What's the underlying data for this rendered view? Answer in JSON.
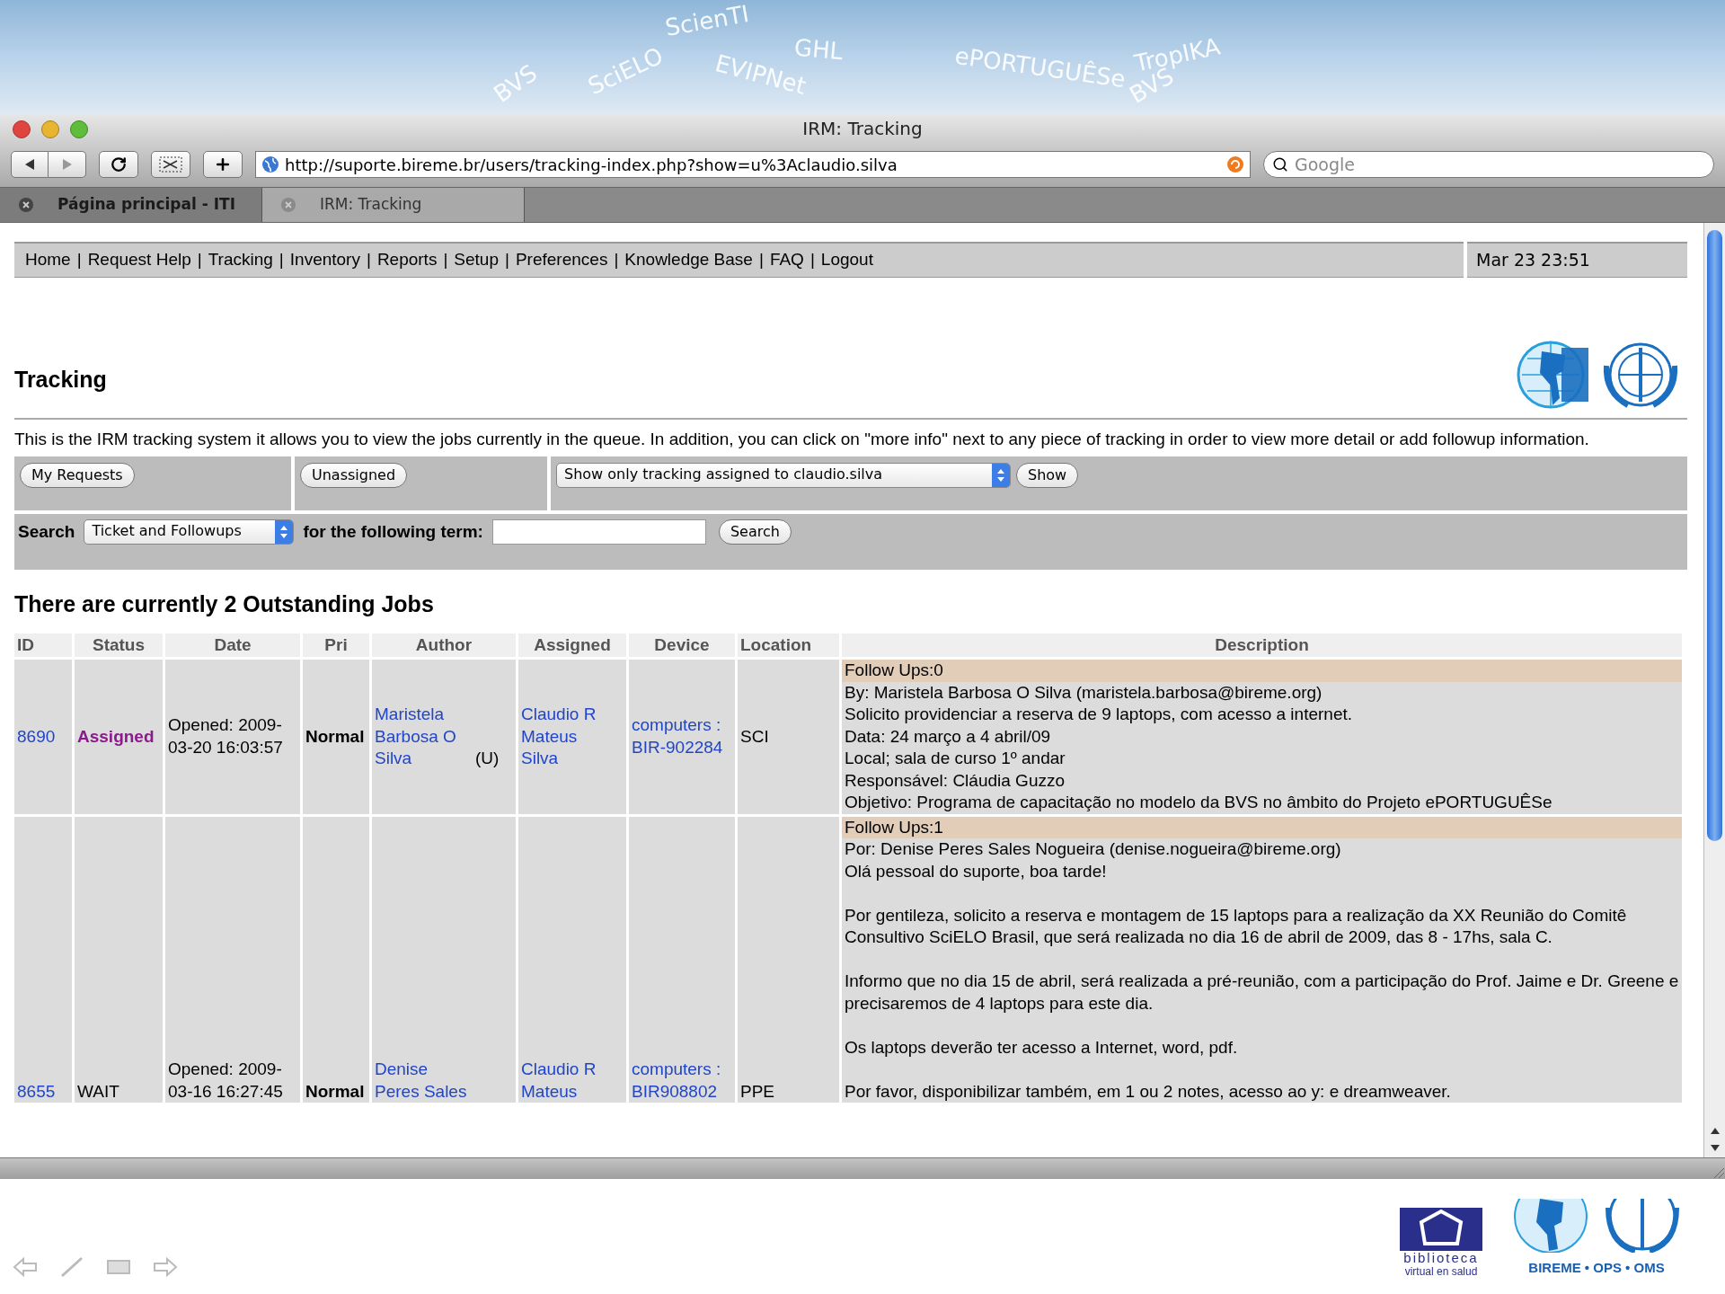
{
  "banner": {
    "words": [
      "ScienTI",
      "GHL",
      "BVS",
      "SciELO",
      "EVIPNet",
      "ePORTUGUÊSe",
      "TropIKA",
      "BVS"
    ]
  },
  "window": {
    "title": "IRM: Tracking"
  },
  "toolbar": {
    "url": "http://suporte.bireme.br/users/tracking-index.php?show=u%3Aclaudio.silva",
    "search_placeholder": "Google"
  },
  "tabs": [
    {
      "label": "Página principal - ITI",
      "selected": false
    },
    {
      "label": "IRM: Tracking",
      "selected": true
    }
  ],
  "nav": {
    "separator": "|",
    "items": [
      "Home",
      "Request Help",
      "Tracking",
      "Inventory",
      "Reports",
      "Setup",
      "Preferences",
      "Knowledge Base",
      "FAQ",
      "Logout"
    ],
    "clock": "Mar 23 23:51"
  },
  "page": {
    "title": "Tracking",
    "intro": "This is the IRM tracking system it allows you to view the jobs currently in the queue. In addition, you can click on \"more info\" next to any piece of tracking in order to view more detail or add followup information."
  },
  "filters": {
    "buttons": [
      "My Requests",
      "Unassigned"
    ],
    "select": "Show only tracking assigned to claudio.silva",
    "show_button": "Show"
  },
  "search": {
    "label": "Search",
    "select": "Ticket and Followups",
    "term_label": "for the following term:",
    "button": "Search"
  },
  "jobs_heading": "There are currently 2 Outstanding Jobs",
  "table": {
    "columns": [
      "ID",
      "Status",
      "Date",
      "Pri",
      "Author",
      "Assigned",
      "Device",
      "Location",
      "Description"
    ],
    "rows": [
      {
        "id": "8690",
        "status": "Assigned",
        "status_highlighted": true,
        "date": "Opened: 2009-03-20 16:03:57",
        "pri": "Normal",
        "author": "Maristela Barbosa O Silva",
        "author_suffix": "(U)",
        "assigned": "Claudio R Mateus Silva",
        "device": "computers : BIR-902284",
        "location": "SCI",
        "followups": "Follow Ups:0",
        "paragraphs": [
          [
            "By: Maristela Barbosa O Silva (maristela.barbosa@bireme.org)",
            "Solicito providenciar a reserva de 9 laptops, com acesso a internet.",
            "Data: 24 março a 4 abril/09",
            "Local; sala de curso 1º andar",
            "Responsável: Cláudia Guzzo",
            "Objetivo: Programa de capacitação no modelo da BVS no âmbito do Projeto ePORTUGUÊSe"
          ]
        ]
      },
      {
        "id": "8655",
        "status": "WAIT",
        "status_highlighted": false,
        "date": "Opened: 2009-03-16 16:27:45",
        "pri": "Normal",
        "author": "Denise Peres Sales",
        "assigned": "Claudio R Mateus",
        "device": "computers : BIR908802",
        "location": "PPE",
        "followups": "Follow Ups:1",
        "paragraphs": [
          [
            "Por: Denise Peres Sales Nogueira (denise.nogueira@bireme.org)",
            "Olá pessoal do suporte, boa tarde!"
          ],
          [
            "Por gentileza, solicito a reserva e montagem de 15 laptops para a realização da XX Reunião do Comitê Consultivo SciELO Brasil, que será realizada no dia 16 de abril de 2009, das 8 - 17hs, sala C."
          ],
          [
            "Informo que no dia 15 de abril, será realizada a pré-reunião, com a participação do Prof. Jaime e Dr. Greene e precisaremos de 4 laptops para este dia."
          ],
          [
            "Os laptops deverão ter acesso a Internet, word, pdf."
          ],
          [
            "Por favor, disponibilizar também, em 1 ou 2 notes, acesso ao y: e dreamweaver."
          ]
        ]
      }
    ]
  },
  "footer": {
    "library_logo": "biblioteca",
    "library_caption": "virtual en salud",
    "orgs": "BIREME • OPS • OMS"
  }
}
